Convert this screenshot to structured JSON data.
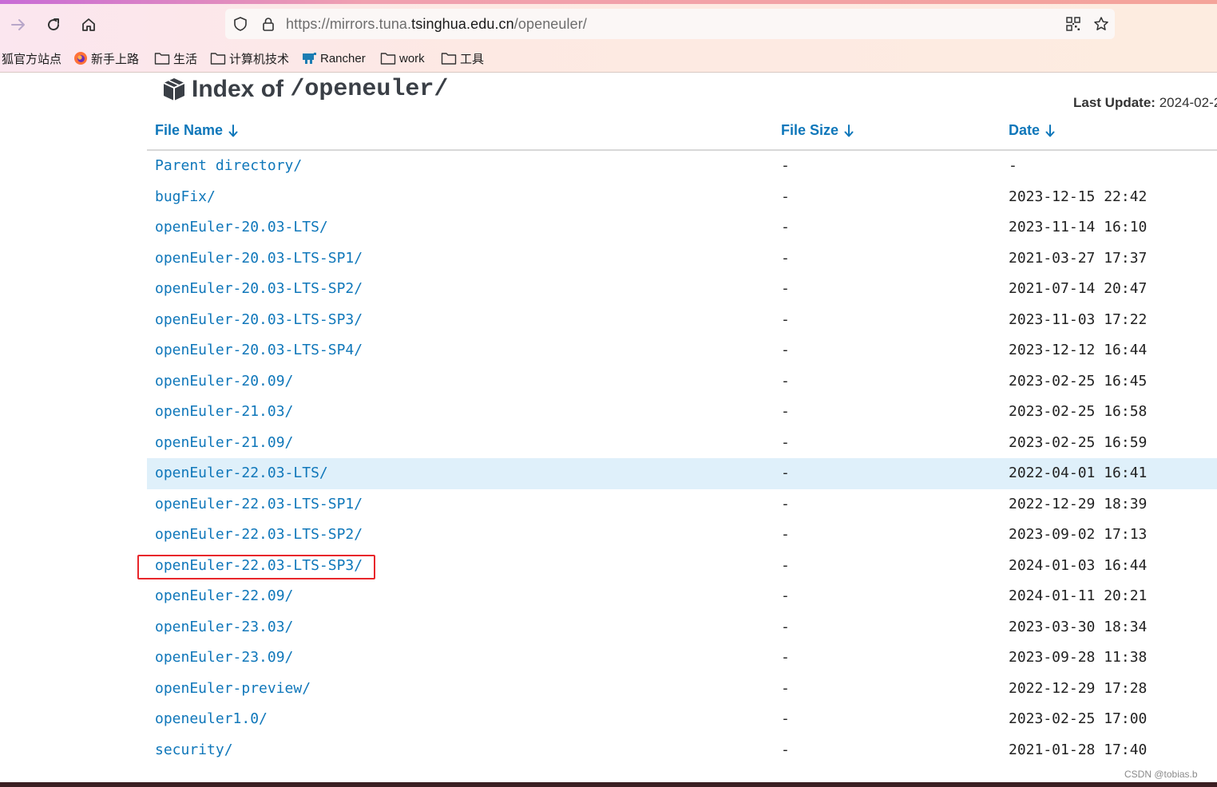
{
  "browser": {
    "url_prefix": "https://mirrors.tuna.",
    "url_host": "tsinghua.edu.cn",
    "url_path": "/openeuler/",
    "bookmarks": [
      {
        "label": "狐官方站点",
        "icon": "none"
      },
      {
        "label": "新手上路",
        "icon": "firefox-icon"
      },
      {
        "label": "生活",
        "icon": "folder-icon"
      },
      {
        "label": "计算机技术",
        "icon": "folder-icon"
      },
      {
        "label": "Rancher",
        "icon": "rancher-icon"
      },
      {
        "label": "work",
        "icon": "folder-icon"
      },
      {
        "label": "工具",
        "icon": "folder-icon"
      }
    ]
  },
  "page": {
    "title_prefix": "Index of ",
    "title_path": "/openeuler/",
    "last_update_label": "Last Update:",
    "last_update_value": "2024-02-2",
    "columns": {
      "name": "File Name",
      "size": "File Size",
      "date": "Date"
    },
    "rows": [
      {
        "name": "Parent directory/",
        "size": "-",
        "date": "-"
      },
      {
        "name": "bugFix/",
        "size": "-",
        "date": "2023-12-15 22:42"
      },
      {
        "name": "openEuler-20.03-LTS/",
        "size": "-",
        "date": "2023-11-14 16:10"
      },
      {
        "name": "openEuler-20.03-LTS-SP1/",
        "size": "-",
        "date": "2021-03-27 17:37"
      },
      {
        "name": "openEuler-20.03-LTS-SP2/",
        "size": "-",
        "date": "2021-07-14 20:47"
      },
      {
        "name": "openEuler-20.03-LTS-SP3/",
        "size": "-",
        "date": "2023-11-03 17:22"
      },
      {
        "name": "openEuler-20.03-LTS-SP4/",
        "size": "-",
        "date": "2023-12-12 16:44"
      },
      {
        "name": "openEuler-20.09/",
        "size": "-",
        "date": "2023-02-25 16:45"
      },
      {
        "name": "openEuler-21.03/",
        "size": "-",
        "date": "2023-02-25 16:58"
      },
      {
        "name": "openEuler-21.09/",
        "size": "-",
        "date": "2023-02-25 16:59"
      },
      {
        "name": "openEuler-22.03-LTS/",
        "size": "-",
        "date": "2022-04-01 16:41"
      },
      {
        "name": "openEuler-22.03-LTS-SP1/",
        "size": "-",
        "date": "2022-12-29 18:39"
      },
      {
        "name": "openEuler-22.03-LTS-SP2/",
        "size": "-",
        "date": "2023-09-02 17:13"
      },
      {
        "name": "openEuler-22.03-LTS-SP3/",
        "size": "-",
        "date": "2024-01-03 16:44"
      },
      {
        "name": "openEuler-22.09/",
        "size": "-",
        "date": "2024-01-11 20:21"
      },
      {
        "name": "openEuler-23.03/",
        "size": "-",
        "date": "2023-03-30 18:34"
      },
      {
        "name": "openEuler-23.09/",
        "size": "-",
        "date": "2023-09-28 11:38"
      },
      {
        "name": "openEuler-preview/",
        "size": "-",
        "date": "2022-12-29 17:28"
      },
      {
        "name": "openeuler1.0/",
        "size": "-",
        "date": "2023-02-25 17:00"
      },
      {
        "name": "security/",
        "size": "-",
        "date": "2021-01-28 17:40"
      }
    ],
    "hovered_row": "openEuler-22.03-LTS/",
    "annotated_row": "openEuler-22.03-LTS-SP3/"
  },
  "watermark": "CSDN @tobias.b",
  "colors": {
    "link": "#0f77ba",
    "highlight_row": "#dff0fa",
    "annotation_box": "#e8262b"
  }
}
